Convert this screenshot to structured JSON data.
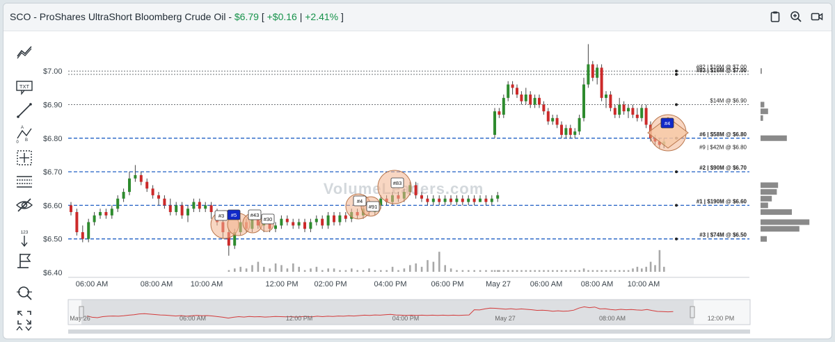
{
  "header": {
    "title": "SCO - ProShares UltraShort Bloomberg Crude Oil - ",
    "price": "$6.79",
    "open_bracket": " [ ",
    "change": "+$0.16",
    "pipe": " | ",
    "change_pct": "+2.41%",
    "close_bracket": " ]"
  },
  "toolbar": {
    "icons": [
      "trend-line-icon",
      "text-icon",
      "line-icon",
      "fib-icon",
      "crosshair-icon",
      "grid-icon",
      "hide-icon",
      "sort-icon",
      "flag-icon",
      "zoom-icon",
      "expand-icon"
    ],
    "text_label": "TXT",
    "sort_label": "123"
  },
  "watermark": "VolumeLeaders.com",
  "chart_data": {
    "type": "candlestick",
    "ylim": [
      6.4,
      7.05
    ],
    "yticks": [
      "$7.00",
      "$6.90",
      "$6.80",
      "$6.70",
      "$6.60",
      "$6.50",
      "$6.40"
    ],
    "ytick_values": [
      7.0,
      6.9,
      6.8,
      6.7,
      6.6,
      6.5,
      6.4
    ],
    "xticks": [
      "06:00 AM",
      "08:00 AM",
      "10:00 AM",
      "12:00 PM",
      "02:00 PM",
      "04:00 PM",
      "06:00 PM",
      "May 27",
      "06:00 AM",
      "08:00 AM",
      "10:00 AM"
    ],
    "levels": [
      {
        "value": 7.0,
        "style": "dotted",
        "label": "#82 | $16M @ $7.00"
      },
      {
        "value": 6.99,
        "style": "dotted",
        "label": "#83 | $16M @ $7.00"
      },
      {
        "value": 6.9,
        "style": "dotted",
        "label": "$14M @ $6.90"
      },
      {
        "value": 6.8,
        "style": "dashed",
        "label": "#6 | $58M @ $6.80"
      },
      {
        "value": 6.79,
        "style": "none",
        "label": "#9 | $42M @ $6.80"
      },
      {
        "value": 6.7,
        "style": "dashed",
        "label": "#2 | $90M @ $6.70"
      },
      {
        "value": 6.6,
        "style": "dashed",
        "label": "#1 | $190M @ $6.60"
      },
      {
        "value": 6.5,
        "style": "dashed",
        "label": "#3 | $74M @ $6.50"
      }
    ],
    "trade_markers": [
      "#3",
      "#5",
      "#43",
      "#30",
      "#4",
      "#91",
      "#83",
      "#4"
    ],
    "volume_profile": [
      {
        "price": 7.0,
        "value": 2
      },
      {
        "price": 6.9,
        "value": 6
      },
      {
        "price": 6.88,
        "value": 12
      },
      {
        "price": 6.86,
        "value": 4
      },
      {
        "price": 6.8,
        "value": 42
      },
      {
        "price": 6.66,
        "value": 28
      },
      {
        "price": 6.64,
        "value": 26
      },
      {
        "price": 6.62,
        "value": 18
      },
      {
        "price": 6.6,
        "value": 12
      },
      {
        "price": 6.58,
        "value": 50
      },
      {
        "price": 6.55,
        "value": 78
      },
      {
        "price": 6.53,
        "value": 62
      },
      {
        "price": 6.5,
        "value": 10
      }
    ],
    "candles_day1": [
      [
        6.6,
        6.58,
        6.61,
        6.57
      ],
      [
        6.58,
        6.52,
        6.59,
        6.51
      ],
      [
        6.52,
        6.5,
        6.54,
        6.49
      ],
      [
        6.5,
        6.55,
        6.56,
        6.49
      ],
      [
        6.55,
        6.57,
        6.58,
        6.54
      ],
      [
        6.57,
        6.58,
        6.59,
        6.56
      ],
      [
        6.58,
        6.57,
        6.59,
        6.56
      ],
      [
        6.57,
        6.59,
        6.6,
        6.56
      ],
      [
        6.59,
        6.62,
        6.63,
        6.58
      ],
      [
        6.62,
        6.64,
        6.65,
        6.61
      ],
      [
        6.64,
        6.68,
        6.7,
        6.63
      ],
      [
        6.68,
        6.69,
        6.72,
        6.67
      ],
      [
        6.69,
        6.67,
        6.7,
        6.66
      ],
      [
        6.67,
        6.65,
        6.68,
        6.64
      ],
      [
        6.65,
        6.63,
        6.66,
        6.62
      ],
      [
        6.63,
        6.62,
        6.64,
        6.6
      ],
      [
        6.62,
        6.6,
        6.63,
        6.59
      ],
      [
        6.6,
        6.58,
        6.62,
        6.57
      ],
      [
        6.58,
        6.6,
        6.61,
        6.57
      ],
      [
        6.6,
        6.57,
        6.61,
        6.56
      ],
      [
        6.57,
        6.59,
        6.6,
        6.55
      ],
      [
        6.59,
        6.61,
        6.62,
        6.58
      ],
      [
        6.61,
        6.59,
        6.62,
        6.58
      ],
      [
        6.59,
        6.6,
        6.61,
        6.58
      ],
      [
        6.6,
        6.58,
        6.61,
        6.56
      ],
      [
        6.58,
        6.55,
        6.59,
        6.54
      ],
      [
        6.55,
        6.52,
        6.56,
        6.5
      ],
      [
        6.52,
        6.48,
        6.53,
        6.45
      ],
      [
        6.48,
        6.52,
        6.53,
        6.47
      ],
      [
        6.52,
        6.55,
        6.56,
        6.51
      ],
      [
        6.55,
        6.53,
        6.56,
        6.52
      ],
      [
        6.53,
        6.56,
        6.57,
        6.52
      ],
      [
        6.56,
        6.54,
        6.57,
        6.53
      ],
      [
        6.54,
        6.55,
        6.56,
        6.52
      ],
      [
        6.55,
        6.53,
        6.56,
        6.52
      ],
      [
        6.53,
        6.54,
        6.55,
        6.52
      ],
      [
        6.54,
        6.56,
        6.57,
        6.53
      ],
      [
        6.56,
        6.55,
        6.57,
        6.54
      ],
      [
        6.55,
        6.54,
        6.56,
        6.53
      ],
      [
        6.54,
        6.55,
        6.56,
        6.53
      ],
      [
        6.55,
        6.53,
        6.56,
        6.52
      ],
      [
        6.53,
        6.55,
        6.56,
        6.52
      ],
      [
        6.55,
        6.56,
        6.57,
        6.54
      ],
      [
        6.56,
        6.54,
        6.57,
        6.53
      ],
      [
        6.54,
        6.57,
        6.58,
        6.53
      ],
      [
        6.57,
        6.55,
        6.58,
        6.54
      ],
      [
        6.55,
        6.57,
        6.58,
        6.54
      ],
      [
        6.57,
        6.56,
        6.58,
        6.55
      ],
      [
        6.56,
        6.58,
        6.59,
        6.55
      ],
      [
        6.58,
        6.57,
        6.59,
        6.56
      ],
      [
        6.57,
        6.59,
        6.6,
        6.56
      ],
      [
        6.59,
        6.58,
        6.61,
        6.57
      ],
      [
        6.58,
        6.6,
        6.61,
        6.57
      ],
      [
        6.6,
        6.62,
        6.63,
        6.59
      ],
      [
        6.62,
        6.61,
        6.63,
        6.6
      ],
      [
        6.61,
        6.63,
        6.64,
        6.6
      ],
      [
        6.63,
        6.62,
        6.64,
        6.61
      ],
      [
        6.62,
        6.64,
        6.65,
        6.61
      ],
      [
        6.64,
        6.66,
        6.67,
        6.63
      ],
      [
        6.66,
        6.63,
        6.67,
        6.62
      ],
      [
        6.63,
        6.62,
        6.64,
        6.61
      ],
      [
        6.62,
        6.61,
        6.63,
        6.6
      ],
      [
        6.61,
        6.62,
        6.63,
        6.6
      ],
      [
        6.62,
        6.61,
        6.63,
        6.6
      ],
      [
        6.61,
        6.62,
        6.63,
        6.6
      ],
      [
        6.62,
        6.61,
        6.63,
        6.6
      ],
      [
        6.61,
        6.62,
        6.63,
        6.6
      ],
      [
        6.62,
        6.61,
        6.63,
        6.6
      ],
      [
        6.61,
        6.62,
        6.63,
        6.6
      ],
      [
        6.62,
        6.61,
        6.63,
        6.6
      ],
      [
        6.61,
        6.62,
        6.63,
        6.61
      ],
      [
        6.62,
        6.61,
        6.63,
        6.6
      ],
      [
        6.61,
        6.62,
        6.63,
        6.6
      ],
      [
        6.62,
        6.63,
        6.64,
        6.61
      ]
    ],
    "candles_day2": [
      [
        6.81,
        6.88,
        6.89,
        6.8
      ],
      [
        6.88,
        6.87,
        6.89,
        6.86
      ],
      [
        6.87,
        6.92,
        6.93,
        6.86
      ],
      [
        6.92,
        6.96,
        6.97,
        6.91
      ],
      [
        6.96,
        6.95,
        6.97,
        6.93
      ],
      [
        6.95,
        6.93,
        6.96,
        6.92
      ],
      [
        6.93,
        6.91,
        6.94,
        6.9
      ],
      [
        6.91,
        6.93,
        6.95,
        6.9
      ],
      [
        6.93,
        6.9,
        6.94,
        6.89
      ],
      [
        6.9,
        6.92,
        6.93,
        6.89
      ],
      [
        6.92,
        6.9,
        6.93,
        6.89
      ],
      [
        6.9,
        6.88,
        6.91,
        6.87
      ],
      [
        6.88,
        6.85,
        6.89,
        6.84
      ],
      [
        6.85,
        6.86,
        6.87,
        6.84
      ],
      [
        6.86,
        6.84,
        6.87,
        6.83
      ],
      [
        6.84,
        6.81,
        6.85,
        6.8
      ],
      [
        6.81,
        6.83,
        6.84,
        6.8
      ],
      [
        6.83,
        6.81,
        6.84,
        6.8
      ],
      [
        6.81,
        6.82,
        6.83,
        6.8
      ],
      [
        6.82,
        6.86,
        6.87,
        6.81
      ],
      [
        6.86,
        6.96,
        6.98,
        6.85
      ],
      [
        6.96,
        7.02,
        7.08,
        6.95
      ],
      [
        7.02,
        6.98,
        7.03,
        6.97
      ],
      [
        6.98,
        7.01,
        7.02,
        6.96
      ],
      [
        7.01,
        6.92,
        7.02,
        6.91
      ],
      [
        6.92,
        6.93,
        6.94,
        6.89
      ],
      [
        6.93,
        6.89,
        6.94,
        6.88
      ],
      [
        6.89,
        6.87,
        6.9,
        6.86
      ],
      [
        6.87,
        6.9,
        6.92,
        6.86
      ],
      [
        6.9,
        6.88,
        6.91,
        6.87
      ],
      [
        6.88,
        6.89,
        6.9,
        6.86
      ],
      [
        6.89,
        6.87,
        6.9,
        6.86
      ],
      [
        6.87,
        6.86,
        6.89,
        6.85
      ],
      [
        6.86,
        6.89,
        6.9,
        6.85
      ],
      [
        6.89,
        6.84,
        6.9,
        6.83
      ],
      [
        6.84,
        6.8,
        6.85,
        6.79
      ],
      [
        6.8,
        6.79,
        6.81,
        6.78
      ],
      [
        6.79,
        6.78,
        6.8,
        6.77
      ],
      [
        6.78,
        6.79,
        6.8,
        6.77
      ]
    ],
    "volumes_day1": [
      0,
      0,
      0,
      0,
      0,
      0,
      0,
      0,
      0,
      0,
      0,
      0,
      0,
      0,
      0,
      0,
      0,
      0,
      0,
      0,
      0,
      0,
      0,
      0,
      0,
      0,
      0,
      1,
      2,
      3,
      2,
      4,
      6,
      3,
      2,
      5,
      4,
      2,
      5,
      3,
      1,
      2,
      3,
      1,
      2,
      2,
      1,
      1,
      2,
      1,
      1,
      2,
      1,
      1,
      1,
      3,
      1,
      2,
      4,
      5,
      3,
      7,
      6,
      12,
      4,
      2,
      1,
      1,
      1,
      1,
      1,
      1,
      1,
      1
    ],
    "volumes_day2": [
      1,
      1,
      1,
      1,
      1,
      1,
      1,
      1,
      1,
      1,
      1,
      1,
      1,
      1,
      1,
      1,
      1,
      1,
      1,
      1,
      2,
      1,
      1,
      1,
      1,
      1,
      1,
      1,
      1,
      1,
      1,
      2,
      3,
      2,
      3,
      6,
      4,
      13,
      3
    ],
    "navigator": {
      "labels": [
        "May 26",
        "06:00 AM",
        "12:00 PM",
        "04:00 PM",
        "May 27",
        "08:00 AM",
        "12:00 PM"
      ]
    }
  }
}
